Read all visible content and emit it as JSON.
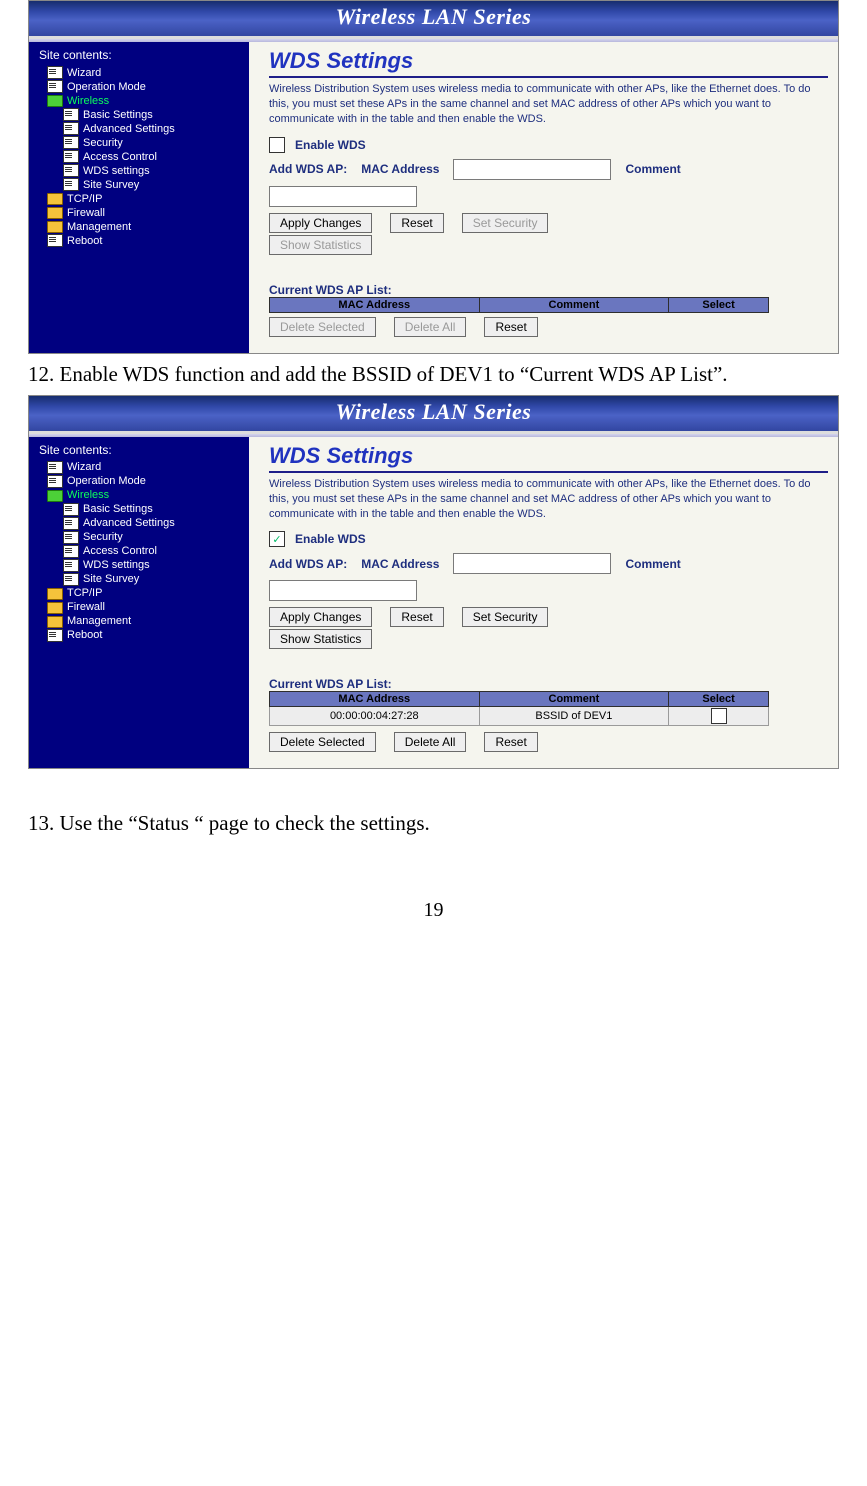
{
  "banner": "Wireless LAN Series",
  "sidebar": {
    "title": "Site contents:",
    "items": [
      {
        "label": "Wizard",
        "ic": "doc",
        "lv": "top"
      },
      {
        "label": "Operation Mode",
        "ic": "doc",
        "lv": "top"
      },
      {
        "label": "Wireless",
        "ic": "open",
        "lv": "top",
        "active": true
      },
      {
        "label": "Basic Settings",
        "ic": "doc",
        "lv": "sub"
      },
      {
        "label": "Advanced Settings",
        "ic": "doc",
        "lv": "sub"
      },
      {
        "label": "Security",
        "ic": "doc",
        "lv": "sub"
      },
      {
        "label": "Access Control",
        "ic": "doc",
        "lv": "sub"
      },
      {
        "label": "WDS settings",
        "ic": "doc",
        "lv": "sub"
      },
      {
        "label": "Site Survey",
        "ic": "doc",
        "lv": "sub"
      },
      {
        "label": "TCP/IP",
        "ic": "fold",
        "lv": "top"
      },
      {
        "label": "Firewall",
        "ic": "fold",
        "lv": "top"
      },
      {
        "label": "Management",
        "ic": "fold",
        "lv": "top"
      },
      {
        "label": "Reboot",
        "ic": "doc",
        "lv": "top"
      }
    ]
  },
  "wds": {
    "heading": "WDS Settings",
    "desc": "Wireless Distribution System uses wireless media to communicate with other APs, like the Ethernet does. To do this, you must set these APs in the same channel and set MAC address of other APs which you want to communicate with in the table and then enable the WDS.",
    "enable_label": "Enable WDS",
    "add_label": "Add WDS AP:",
    "mac_label": "MAC Address",
    "comment_label": "Comment",
    "apply": "Apply Changes",
    "reset": "Reset",
    "set_sec": "Set Security",
    "show_stats": "Show Statistics",
    "list_label": "Current WDS AP List:",
    "th_mac": "MAC Address",
    "th_comment": "Comment",
    "th_select": "Select",
    "del_sel": "Delete Selected",
    "del_all": "Delete All",
    "reset2": "Reset"
  },
  "shot2_row": {
    "mac": "00:00:00:04:27:28",
    "comment": "BSSID of DEV1"
  },
  "step12": "12. Enable WDS function and add the BSSID of DEV1 to “Current WDS AP List”.",
  "step13": "13. Use the “Status “ page to check the settings.",
  "page_num": "19"
}
